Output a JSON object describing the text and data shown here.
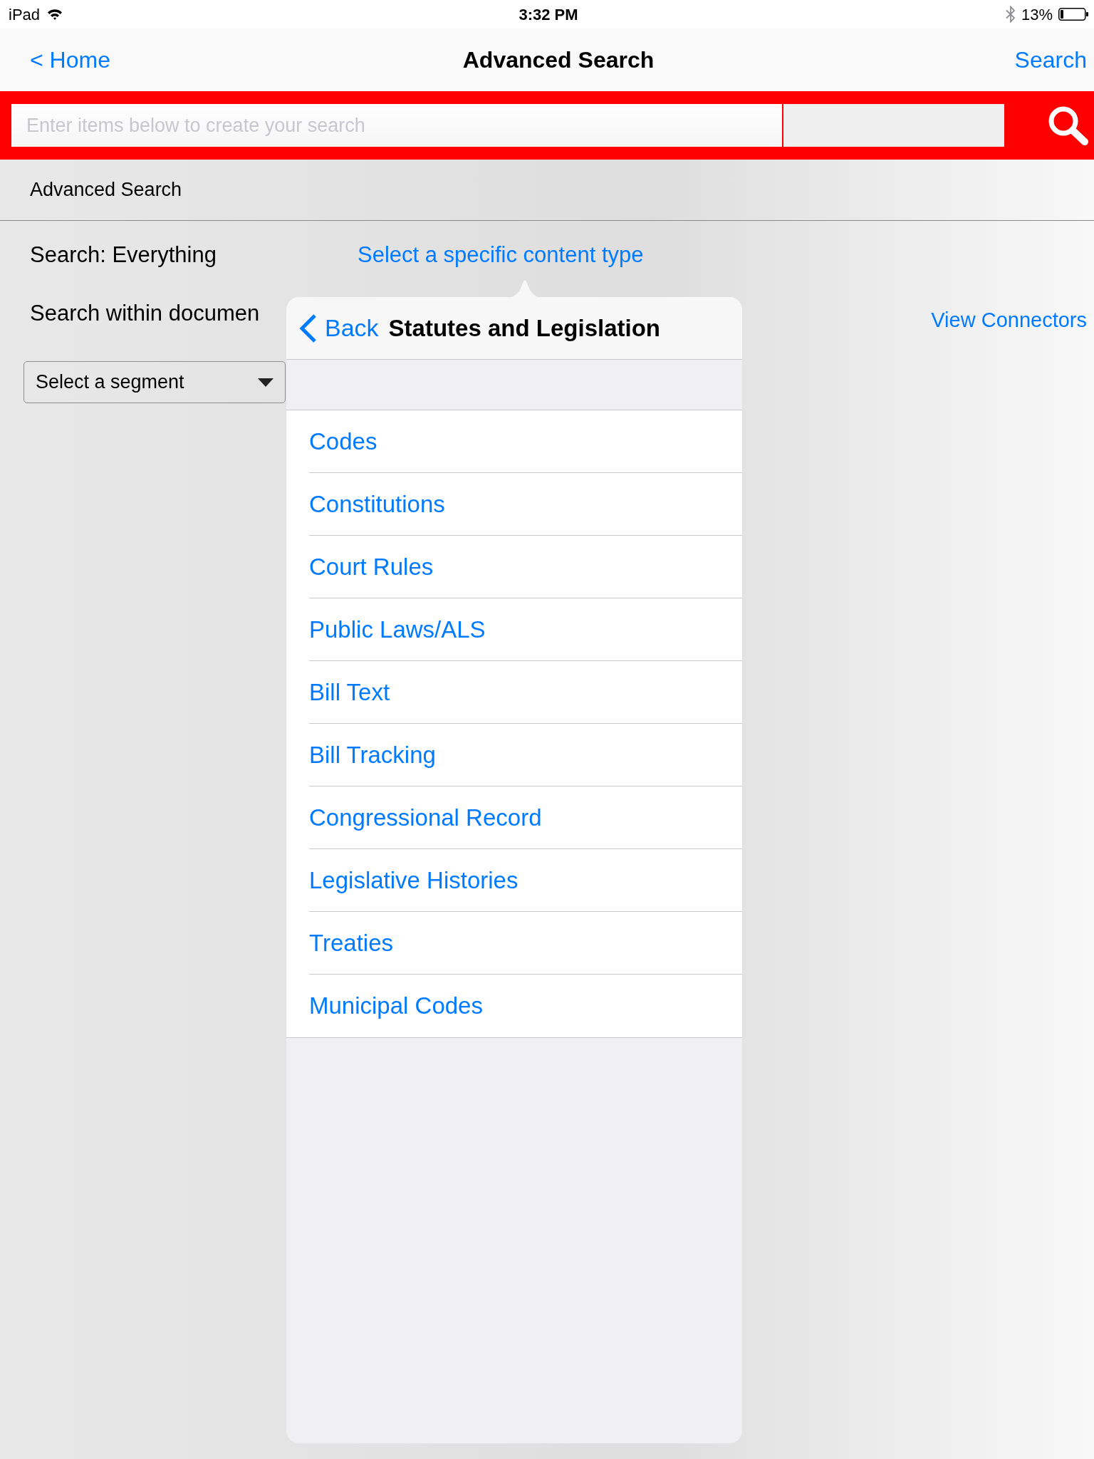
{
  "status_bar": {
    "carrier": "iPad",
    "time": "3:32 PM",
    "battery": "13%"
  },
  "nav_bar": {
    "back": "< Home",
    "title": "Advanced Search",
    "action": "Search"
  },
  "search_bar": {
    "placeholder": "Enter items below to create your search"
  },
  "section_header": "Advanced Search",
  "search_scope": {
    "label": "Search: Everything",
    "link": "Select a specific content type"
  },
  "within_document": {
    "label": "Search within documen",
    "link": "View Connectors"
  },
  "segment_select": {
    "value": "Select a segment"
  },
  "popover": {
    "back": "Back",
    "title": "Statutes and Legislation",
    "items": [
      "Codes",
      "Constitutions",
      "Court Rules",
      "Public Laws/ALS",
      "Bill Text",
      "Bill Tracking",
      "Congressional Record",
      "Legislative Histories",
      "Treaties",
      "Municipal Codes"
    ]
  }
}
